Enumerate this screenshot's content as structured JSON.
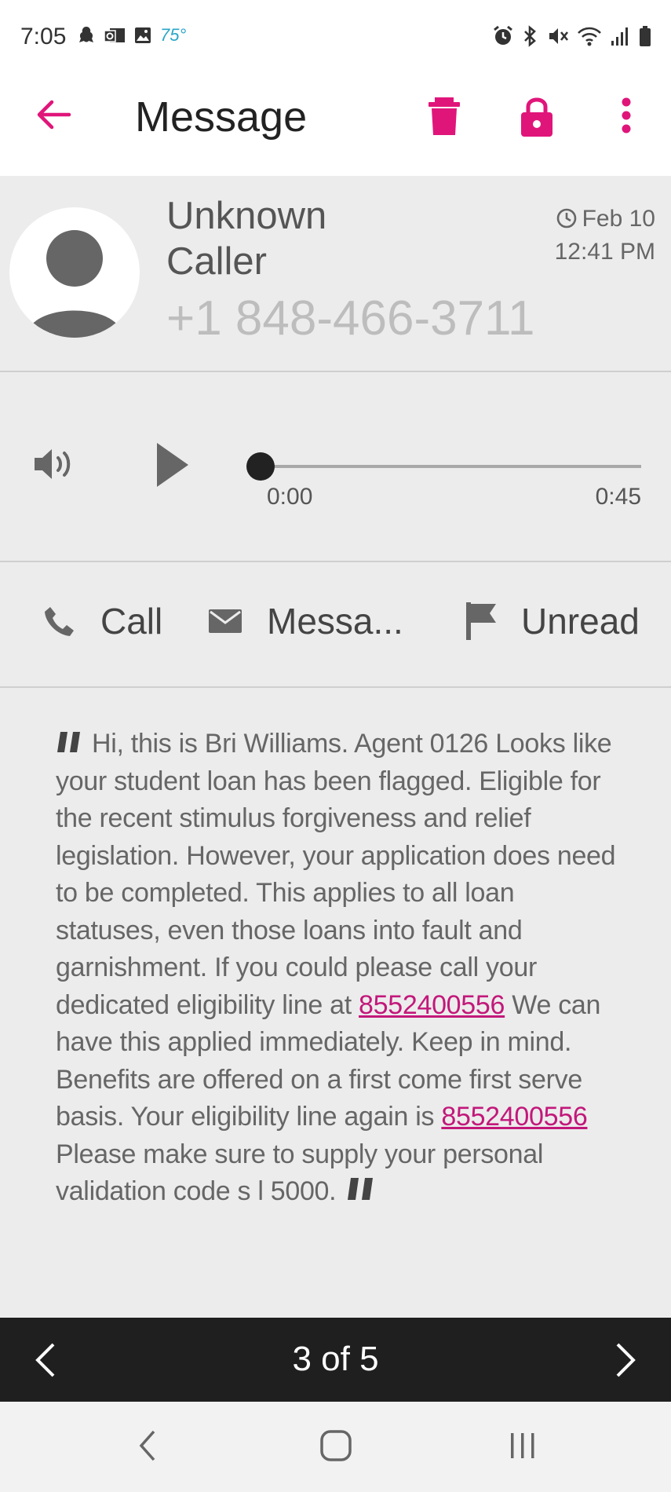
{
  "status_bar": {
    "time": "7:05",
    "temperature": "75°",
    "left_icons": [
      "notification-icon",
      "outlook-icon",
      "gallery-icon"
    ],
    "right_icons": [
      "alarm-icon",
      "bluetooth-icon",
      "mute-icon",
      "wifi-icon",
      "signal-icon",
      "battery-icon"
    ]
  },
  "app_bar": {
    "title": "Message",
    "accent_color": "#e0157a",
    "actions": [
      "delete-icon",
      "lock-icon",
      "more-vert-icon"
    ]
  },
  "contact": {
    "name": "Unknown Caller",
    "number": "+1 848-466-3711",
    "date": "Feb 10",
    "time": "12:41 PM"
  },
  "player": {
    "current_time": "0:00",
    "total_time": "0:45",
    "progress": 0
  },
  "actions": {
    "call_label": "Call",
    "message_label": "Messa...",
    "unread_label": "Unread"
  },
  "message": {
    "part1": "Hi, this is Bri Williams. Agent 0126 Looks like your student loan has been flagged. Eligible for the recent stimulus forgiveness and relief legislation. However, your application does need to be completed. This applies to all loan statuses, even those loans into fault and garnishment. If you could please call your dedicated eligibility line at ",
    "link1": "8552400556",
    "part2": " We can have this applied immediately. Keep in mind. Benefits are offered on a first come first serve basis. Your eligibility line again is ",
    "link2": "8552400556",
    "part3": " Please make sure to supply your personal validation code s l 5000."
  },
  "pager": {
    "label": "3 of 5"
  }
}
